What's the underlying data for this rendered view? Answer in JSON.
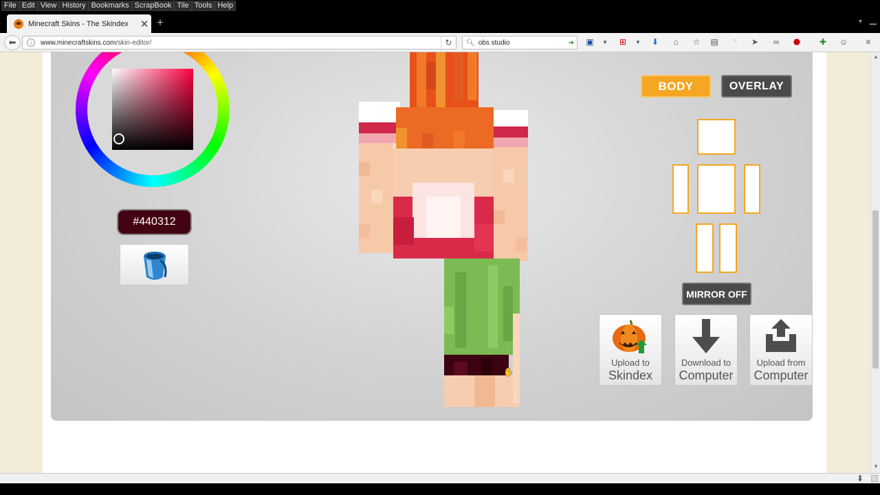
{
  "menubar": {
    "items": [
      "File",
      "Edit",
      "View",
      "History",
      "Bookmarks",
      "ScrapBook",
      "Tile",
      "Tools",
      "Help"
    ]
  },
  "tab": {
    "title": "Minecraft Skins - The Skindex",
    "close": "✕",
    "new_tab": "+"
  },
  "navbar": {
    "url_host": "www.minecraftskins.com",
    "url_path": "/skin-editor/",
    "search_value": "obs studio"
  },
  "editor": {
    "hex_value": "#440312",
    "body_label": "BODY",
    "overlay_label": "OVERLAY",
    "mirror_label": "MIRROR OFF",
    "actions": [
      {
        "small": "Upload to",
        "big": "Skindex",
        "icon": "pumpkin-upload-icon"
      },
      {
        "small": "Download to",
        "big": "Computer",
        "icon": "download-arrow-icon"
      },
      {
        "small": "Upload from",
        "big": "Computer",
        "icon": "upload-box-icon"
      }
    ]
  },
  "colors": {
    "accent": "#f5a623",
    "dark_button": "#4a4a4a",
    "selected_color": "#440312",
    "page_bg": "#f3ecd9"
  }
}
